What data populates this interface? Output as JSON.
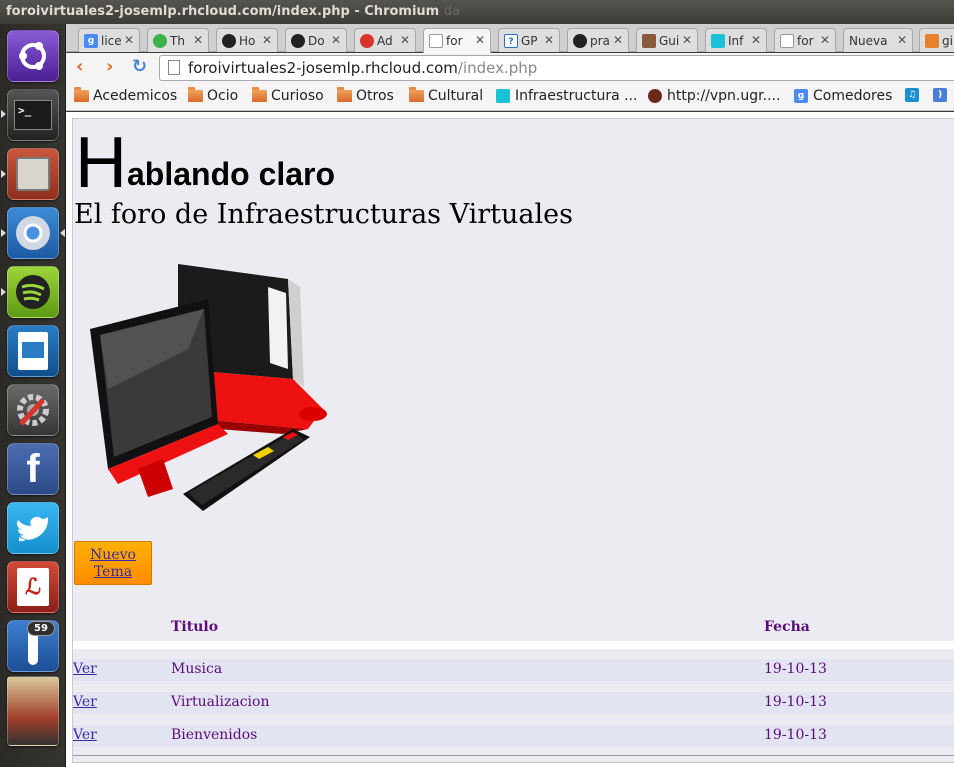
{
  "window": {
    "title": "foroivirtuales2-josemlp.rhcloud.com/index.php - Chromium",
    "title_ghost": "da"
  },
  "launcher": {
    "badge": "59",
    "apps": [
      "ubuntu-dash",
      "terminal",
      "file-manager",
      "chromium",
      "spotify",
      "libreoffice-impress",
      "system-settings",
      "facebook",
      "twitter",
      "pdf-reader",
      "thermometer",
      "stacked-windows"
    ]
  },
  "tabs": [
    {
      "label": "lice",
      "favicon": "google-icon"
    },
    {
      "label": "Th",
      "favicon": "green-circle-icon"
    },
    {
      "label": "Ho",
      "favicon": "github-icon"
    },
    {
      "label": "Do",
      "favicon": "github-icon"
    },
    {
      "label": "Ad",
      "favicon": "openshift-icon"
    },
    {
      "label": "for",
      "favicon": "page-icon",
      "active": true
    },
    {
      "label": "GP",
      "favicon": "question-icon"
    },
    {
      "label": "pra",
      "favicon": "github-icon"
    },
    {
      "label": "Gui",
      "favicon": "avatar-icon"
    },
    {
      "label": "Inf",
      "favicon": "cyan-app-icon"
    },
    {
      "label": "for",
      "favicon": "page-icon"
    },
    {
      "label": "Nueva",
      "favicon": ""
    },
    {
      "label": "gi",
      "favicon": "stack-icon"
    }
  ],
  "toolbar": {
    "url_host": "foroivirtuales2-josemlp.rhcloud.com",
    "url_path": "/index.php",
    "back": "‹",
    "forward": "›",
    "reload": "↻"
  },
  "bookmarks": [
    {
      "label": "Acedemicos",
      "icon": "folder"
    },
    {
      "label": "Ocio",
      "icon": "folder"
    },
    {
      "label": "Curioso",
      "icon": "folder"
    },
    {
      "label": "Otros",
      "icon": "folder"
    },
    {
      "label": "Cultural",
      "icon": "folder"
    },
    {
      "label": "Infraestructura ...",
      "icon": "cyan-app-icon"
    },
    {
      "label": "http://vpn.ugr....",
      "icon": "ugr-crest-icon"
    },
    {
      "label": "Comedores",
      "icon": "google-icon"
    }
  ],
  "page": {
    "title_drop": "H",
    "title_rest": "ablando claro",
    "subtitle": "El foro de Infraestructuras Virtuales",
    "new_topic_button": "Nuevo Tema",
    "table": {
      "headers": [
        "",
        "Titulo",
        "Fecha"
      ],
      "rows": [
        {
          "link": "Ver",
          "title": "Musica",
          "date": "19-10-13"
        },
        {
          "link": "Ver",
          "title": "Virtualizacion",
          "date": "19-10-13"
        },
        {
          "link": "Ver",
          "title": "Bienvenidos",
          "date": "19-10-13"
        }
      ]
    }
  },
  "colors": {
    "accent_orange": "#ff9a00",
    "page_bg": "#ecebf1",
    "link_purple": "#5b0d7a"
  }
}
